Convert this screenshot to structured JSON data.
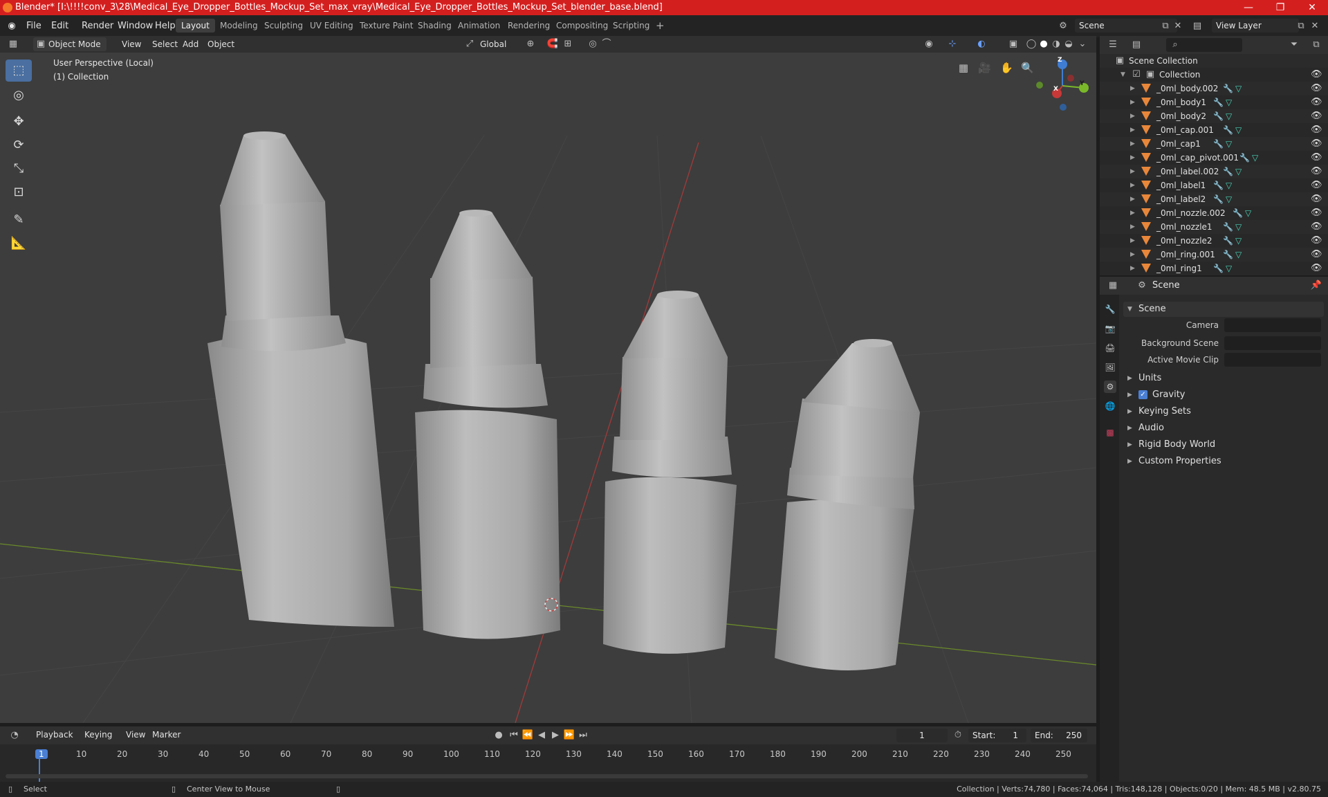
{
  "window": {
    "title": "Blender* [I:\\!!!!conv_3\\28\\Medical_Eye_Dropper_Bottles_Mockup_Set_max_vray\\Medical_Eye_Dropper_Bottles_Mockup_Set_blender_base.blend]",
    "controls": [
      "—",
      "❐",
      "✕"
    ]
  },
  "menu": [
    "File",
    "Edit",
    "Render",
    "Window",
    "Help"
  ],
  "workspaces": [
    "Layout",
    "Modeling",
    "Sculpting",
    "UV Editing",
    "Texture Paint",
    "Shading",
    "Animation",
    "Rendering",
    "Compositing",
    "Scripting"
  ],
  "active_workspace": "Layout",
  "scene_field": "Scene",
  "view_layer_field": "View Layer",
  "viewport_header": {
    "mode": "Object Mode",
    "menus": [
      "View",
      "Select",
      "Add",
      "Object"
    ],
    "orientation": "Global"
  },
  "viewport": {
    "perspective": "User Perspective (Local)",
    "collection": "(1) Collection",
    "gizmo": {
      "z": "Z",
      "y": "Y",
      "x": "X"
    }
  },
  "outliner": {
    "root": "Scene Collection",
    "collection": "Collection",
    "items": [
      "_0ml_body.002",
      "_0ml_body1",
      "_0ml_body2",
      "_0ml_cap.001",
      "_0ml_cap1",
      "_0ml_cap_pivot.001",
      "_0ml_label.002",
      "_0ml_label1",
      "_0ml_label2",
      "_0ml_nozzle.002",
      "_0ml_nozzle1",
      "_0ml_nozzle2",
      "_0ml_ring.001",
      "_0ml_ring1"
    ]
  },
  "properties": {
    "context": "Scene",
    "section": "Scene",
    "fields": {
      "camera": "Camera",
      "background_scene": "Background Scene",
      "active_movie_clip": "Active Movie Clip"
    },
    "panels": [
      "Units",
      "Gravity",
      "Keying Sets",
      "Audio",
      "Rigid Body World",
      "Custom Properties"
    ]
  },
  "timeline": {
    "menus": [
      "Playback",
      "Keying",
      "View",
      "Marker"
    ],
    "current_frame": "1",
    "start_label": "Start:",
    "start": "1",
    "end_label": "End:",
    "end": "250",
    "ticks": [
      "1",
      "10",
      "20",
      "30",
      "40",
      "50",
      "60",
      "70",
      "80",
      "90",
      "100",
      "110",
      "120",
      "130",
      "140",
      "150",
      "160",
      "170",
      "180",
      "190",
      "200",
      "210",
      "220",
      "230",
      "240",
      "250"
    ]
  },
  "statusbar": {
    "left": "Select",
    "middle": "Center View to Mouse",
    "stats": "Collection | Verts:74,780 | Faces:74,064 | Tris:148,128 | Objects:0/20 | Mem: 48.5 MB | v2.80.75"
  }
}
